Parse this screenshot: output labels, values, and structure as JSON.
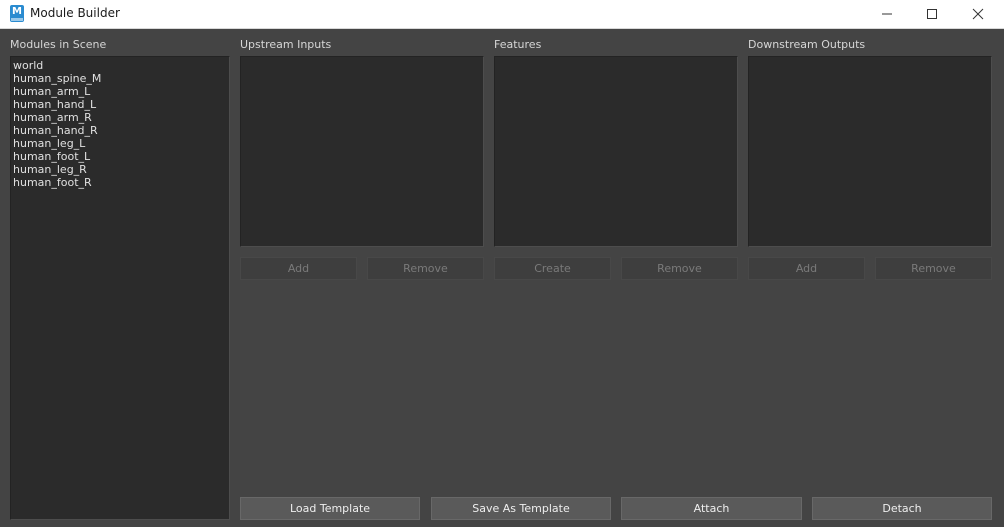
{
  "window": {
    "title": "Module Builder",
    "icon_letter": "M"
  },
  "modules": {
    "label": "Modules in Scene",
    "items": [
      "world",
      "human_spine_M",
      "human_arm_L",
      "human_hand_L",
      "human_arm_R",
      "human_hand_R",
      "human_leg_L",
      "human_foot_L",
      "human_leg_R",
      "human_foot_R"
    ]
  },
  "upstream": {
    "label": "Upstream Inputs",
    "add": "Add",
    "remove": "Remove"
  },
  "features": {
    "label": "Features",
    "create": "Create",
    "remove": "Remove"
  },
  "downstream": {
    "label": "Downstream Outputs",
    "add": "Add",
    "remove": "Remove"
  },
  "footer": {
    "load_template": "Load Template",
    "save_as_template": "Save As Template",
    "attach": "Attach",
    "detach": "Detach"
  },
  "colors": {
    "background": "#444444",
    "panel": "#2b2b2b",
    "text": "#e0e0e0",
    "disabled_text": "#7a7a7a",
    "button": "#5a5a5a"
  }
}
